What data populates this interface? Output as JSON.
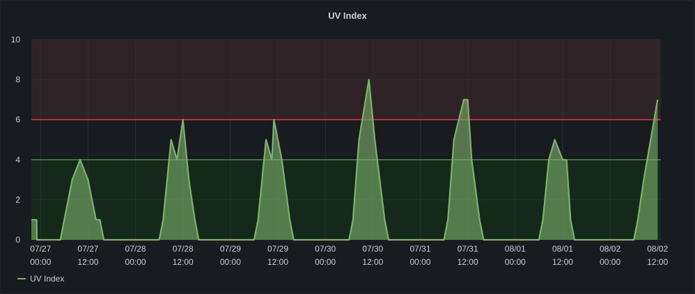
{
  "panel": {
    "title": "UV Index"
  },
  "legend": {
    "label": "UV Index"
  },
  "colors": {
    "series": "#7eb26d",
    "danger_threshold": "#e02f44",
    "warn_threshold": "#56a64b",
    "danger_fill": "#2f2226",
    "warn_fill": "#14291a",
    "grid": "#2c2f35",
    "tick_text": "#ccccdc"
  },
  "chart_data": {
    "type": "area",
    "title": "UV Index",
    "xlabel": "",
    "ylabel": "",
    "ylim": [
      0,
      10
    ],
    "yticks": [
      "0",
      "2",
      "4",
      "6",
      "8",
      "10"
    ],
    "xlim": [
      "2023-07-26 21:40",
      "2023-08-02 12:50"
    ],
    "xticks": [
      {
        "at": "2023-07-27 00:00",
        "l1": "07/27",
        "l2": "00:00"
      },
      {
        "at": "2023-07-27 12:00",
        "l1": "07/27",
        "l2": "12:00"
      },
      {
        "at": "2023-07-28 00:00",
        "l1": "07/28",
        "l2": "00:00"
      },
      {
        "at": "2023-07-28 12:00",
        "l1": "07/28",
        "l2": "12:00"
      },
      {
        "at": "2023-07-29 00:00",
        "l1": "07/29",
        "l2": "00:00"
      },
      {
        "at": "2023-07-29 12:00",
        "l1": "07/29",
        "l2": "12:00"
      },
      {
        "at": "2023-07-30 00:00",
        "l1": "07/30",
        "l2": "00:00"
      },
      {
        "at": "2023-07-30 12:00",
        "l1": "07/30",
        "l2": "12:00"
      },
      {
        "at": "2023-07-31 00:00",
        "l1": "07/31",
        "l2": "00:00"
      },
      {
        "at": "2023-07-31 12:00",
        "l1": "07/31",
        "l2": "12:00"
      },
      {
        "at": "2023-08-01 00:00",
        "l1": "08/01",
        "l2": "00:00"
      },
      {
        "at": "2023-08-01 12:00",
        "l1": "08/01",
        "l2": "12:00"
      },
      {
        "at": "2023-08-02 00:00",
        "l1": "08/02",
        "l2": "00:00"
      },
      {
        "at": "2023-08-02 12:00",
        "l1": "08/02",
        "l2": "12:00"
      }
    ],
    "thresholds": [
      {
        "value": 4,
        "level": "warning"
      },
      {
        "value": 6,
        "level": "critical"
      }
    ],
    "grid": true,
    "legend_position": "bottom-left",
    "series": [
      {
        "name": "UV Index",
        "points": [
          [
            "2023-07-26 21:40",
            1
          ],
          [
            "2023-07-26 23:00",
            1
          ],
          [
            "2023-07-26 23:05",
            0
          ],
          [
            "2023-07-27 05:00",
            0
          ],
          [
            "2023-07-27 06:00",
            1
          ],
          [
            "2023-07-27 07:00",
            2
          ],
          [
            "2023-07-27 08:00",
            3
          ],
          [
            "2023-07-27 10:00",
            4
          ],
          [
            "2023-07-27 12:00",
            3
          ],
          [
            "2023-07-27 14:00",
            1
          ],
          [
            "2023-07-27 15:00",
            1
          ],
          [
            "2023-07-27 16:00",
            0
          ],
          [
            "2023-07-28 06:00",
            0
          ],
          [
            "2023-07-28 07:00",
            1
          ],
          [
            "2023-07-28 08:00",
            3
          ],
          [
            "2023-07-28 09:00",
            5
          ],
          [
            "2023-07-28 10:30",
            4
          ],
          [
            "2023-07-28 12:00",
            6
          ],
          [
            "2023-07-28 13:30",
            3
          ],
          [
            "2023-07-28 15:00",
            1
          ],
          [
            "2023-07-28 16:00",
            0
          ],
          [
            "2023-07-29 06:00",
            0
          ],
          [
            "2023-07-29 07:00",
            1
          ],
          [
            "2023-07-29 09:00",
            5
          ],
          [
            "2023-07-29 10:30",
            4
          ],
          [
            "2023-07-29 11:00",
            6
          ],
          [
            "2023-07-29 13:00",
            4
          ],
          [
            "2023-07-29 15:00",
            1
          ],
          [
            "2023-07-29 16:00",
            0
          ],
          [
            "2023-07-30 06:00",
            0
          ],
          [
            "2023-07-30 07:00",
            1
          ],
          [
            "2023-07-30 08:30",
            5
          ],
          [
            "2023-07-30 11:00",
            8
          ],
          [
            "2023-07-30 12:30",
            5
          ],
          [
            "2023-07-30 15:00",
            1
          ],
          [
            "2023-07-30 16:00",
            0
          ],
          [
            "2023-07-31 06:00",
            0
          ],
          [
            "2023-07-31 07:00",
            1
          ],
          [
            "2023-07-31 08:30",
            5
          ],
          [
            "2023-07-31 11:00",
            7
          ],
          [
            "2023-07-31 12:00",
            7
          ],
          [
            "2023-07-31 13:00",
            4
          ],
          [
            "2023-07-31 15:00",
            1
          ],
          [
            "2023-07-31 16:00",
            0
          ],
          [
            "2023-08-01 06:00",
            0
          ],
          [
            "2023-08-01 07:00",
            1
          ],
          [
            "2023-08-01 08:30",
            4
          ],
          [
            "2023-08-01 10:00",
            5
          ],
          [
            "2023-08-01 12:00",
            4
          ],
          [
            "2023-08-01 13:00",
            4
          ],
          [
            "2023-08-01 14:00",
            1
          ],
          [
            "2023-08-01 15:00",
            0
          ],
          [
            "2023-08-02 06:00",
            0
          ],
          [
            "2023-08-02 07:00",
            1
          ],
          [
            "2023-08-02 08:30",
            3
          ],
          [
            "2023-08-02 12:00",
            7
          ]
        ]
      }
    ]
  }
}
